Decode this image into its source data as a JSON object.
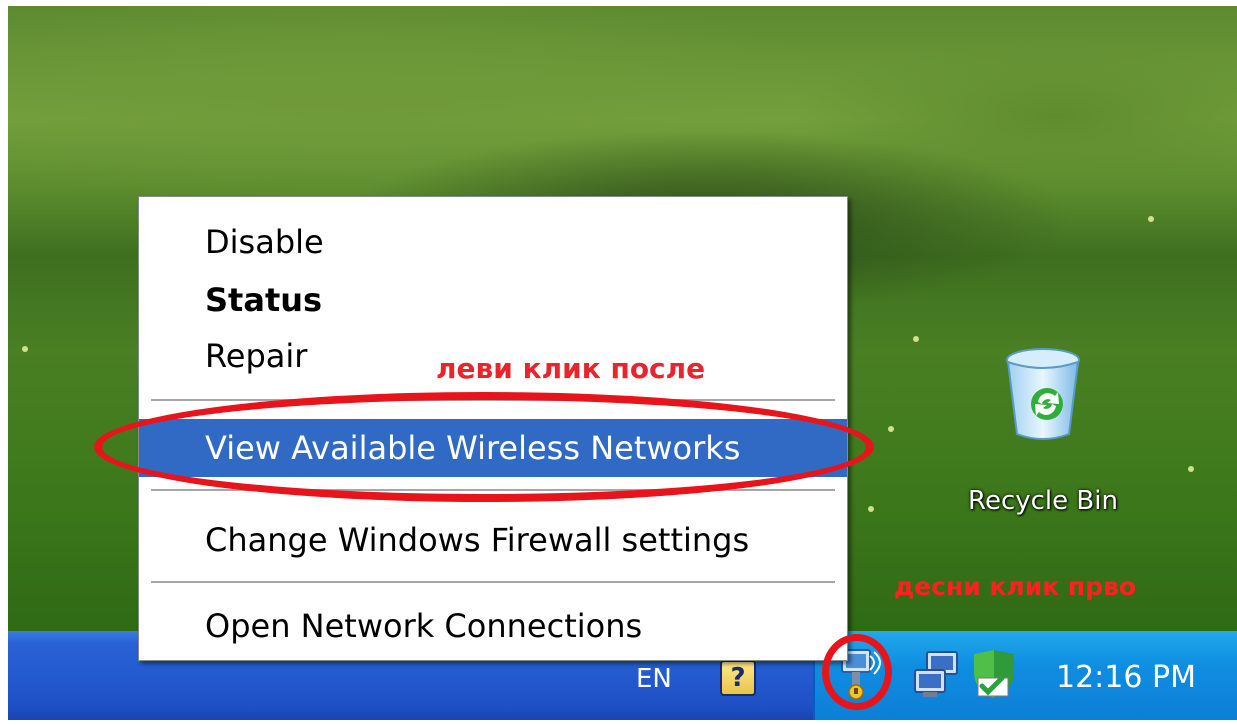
{
  "context_menu": {
    "items": [
      {
        "label": "Disable"
      },
      {
        "label": "Status"
      },
      {
        "label": "Repair"
      },
      {
        "label": "View Available Wireless Networks"
      },
      {
        "label": "Change Windows Firewall settings"
      },
      {
        "label": "Open Network Connections"
      }
    ]
  },
  "desktop": {
    "recycle_bin_label": "Recycle Bin"
  },
  "taskbar": {
    "language": "EN",
    "help_glyph": "?",
    "clock": "12:16 PM",
    "tray_icons": [
      "wireless-network-icon",
      "network-connection-icon",
      "security-center-icon"
    ]
  },
  "annotations": {
    "left_click_after": "леви клик после",
    "right_click_first": "десни клик прво"
  },
  "colors": {
    "menu_highlight": "#316ac5",
    "taskbar": "#245ad0",
    "tray": "#0f8de0",
    "annotation_red": "#e8141c"
  }
}
